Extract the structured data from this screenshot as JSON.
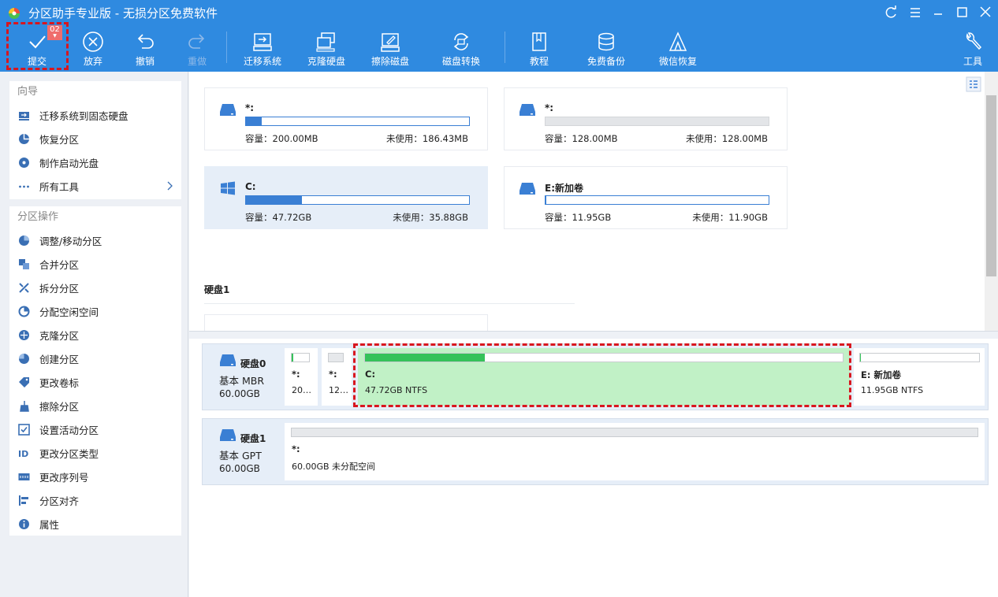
{
  "app": {
    "title": "分区助手专业版 - 无损分区免费软件",
    "colors": {
      "accent": "#2f8ae0",
      "highlight": "#d8161e",
      "used_bar": "#3a7fd4",
      "selected_partition": "#c1f1c6"
    }
  },
  "toolbar": {
    "submit": {
      "label": "提交",
      "badge": "02",
      "icon": "check-icon"
    },
    "discard": {
      "label": "放弃",
      "icon": "close-circle-icon"
    },
    "undo": {
      "label": "撤销",
      "icon": "undo-icon"
    },
    "redo": {
      "label": "重做",
      "icon": "redo-icon"
    },
    "migrate": {
      "label": "迁移系统",
      "icon": "migrate-disk-icon"
    },
    "clone": {
      "label": "克隆硬盘",
      "icon": "clone-disk-icon"
    },
    "wipe": {
      "label": "擦除磁盘",
      "icon": "wipe-disk-icon"
    },
    "convert": {
      "label": "磁盘转换",
      "icon": "convert-disk-icon"
    },
    "tutorial": {
      "label": "教程",
      "icon": "book-icon"
    },
    "backup": {
      "label": "免费备份",
      "icon": "backup-icon"
    },
    "wechat": {
      "label": "微信恢复",
      "icon": "recovery-icon"
    },
    "tools": {
      "label": "工具",
      "icon": "wrench-icon"
    }
  },
  "sidebar": {
    "wizard": {
      "title": "向导",
      "items": [
        {
          "label": "迁移系统到固态硬盘",
          "icon": "migrate-ssd-icon"
        },
        {
          "label": "恢复分区",
          "icon": "recover-partition-icon"
        },
        {
          "label": "制作启动光盘",
          "icon": "boot-disc-icon"
        },
        {
          "label": "所有工具",
          "icon": "more-dots-icon"
        }
      ]
    },
    "operations": {
      "title": "分区操作",
      "items": [
        {
          "label": "调整/移动分区",
          "icon": "resize-icon"
        },
        {
          "label": "合并分区",
          "icon": "merge-icon"
        },
        {
          "label": "拆分分区",
          "icon": "split-icon"
        },
        {
          "label": "分配空闲空间",
          "icon": "allocate-icon"
        },
        {
          "label": "克隆分区",
          "icon": "clone-partition-icon"
        },
        {
          "label": "创建分区",
          "icon": "create-partition-icon"
        },
        {
          "label": "更改卷标",
          "icon": "label-icon"
        },
        {
          "label": "擦除分区",
          "icon": "wipe-partition-icon"
        },
        {
          "label": "设置活动分区",
          "icon": "active-partition-icon"
        },
        {
          "label": "更改分区类型",
          "icon": "id-icon"
        },
        {
          "label": "更改序列号",
          "icon": "serial-icon"
        },
        {
          "label": "分区对齐",
          "icon": "align-icon"
        },
        {
          "label": "属性",
          "icon": "info-icon"
        }
      ]
    }
  },
  "cards": [
    {
      "name": "*:",
      "capacity": "容量：200.00MB",
      "unused": "未使用：186.43MB",
      "used_fraction": 0.07,
      "icon": "drive-icon"
    },
    {
      "name": "*:",
      "capacity": "容量：128.00MB",
      "unused": "未使用：128.00MB",
      "used_fraction": 0,
      "icon": "drive-icon"
    },
    {
      "name": "C:",
      "capacity": "容量：47.72GB",
      "unused": "未使用：35.88GB",
      "used_fraction": 0.25,
      "icon": "windows-icon"
    },
    {
      "name": "E:新加卷",
      "capacity": "容量：11.95GB",
      "unused": "未使用：11.90GB",
      "used_fraction": 0.004,
      "icon": "drive-icon"
    }
  ],
  "section": {
    "disk1_title": "硬盘1"
  },
  "disks": [
    {
      "name": "硬盘0",
      "type": "基本 MBR",
      "size": "60.00GB",
      "partitions": [
        {
          "name": "*:",
          "info": "20…",
          "used_fraction": 0.07
        },
        {
          "name": "*:",
          "info": "12…",
          "used_fraction": 0
        },
        {
          "name": "C:",
          "info": "47.72GB NTFS",
          "used_fraction": 0.25
        },
        {
          "name": "E: 新加卷",
          "info": "11.95GB NTFS",
          "used_fraction": 0.004
        }
      ]
    },
    {
      "name": "硬盘1",
      "type": "基本 GPT",
      "size": "60.00GB",
      "partitions": [
        {
          "name": "*:",
          "info": "60.00GB 未分配空间",
          "used_fraction": 0
        }
      ]
    }
  ]
}
